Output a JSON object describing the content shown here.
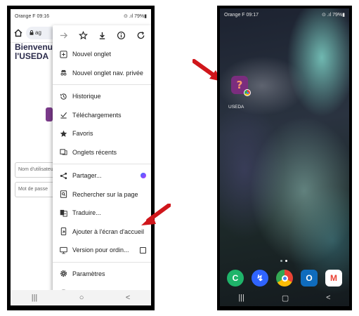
{
  "left_phone": {
    "status": {
      "carrier_time": "Orange F  09:16",
      "indicators": "⊙ .ıl 79%▮"
    },
    "url_text": "ag",
    "page": {
      "title": "Bienvenue l'USEDA",
      "username_placeholder": "Nom d'utilisateur",
      "password_placeholder": "Mot de passe"
    },
    "menu": {
      "items": [
        {
          "label": "Nouvel onglet",
          "icon": "new-tab-icon"
        },
        {
          "label": "Nouvel onglet nav. privée",
          "icon": "incognito-icon"
        },
        {
          "label": "Historique",
          "icon": "history-icon"
        },
        {
          "label": "Téléchargements",
          "icon": "downloads-icon"
        },
        {
          "label": "Favoris",
          "icon": "star-icon"
        },
        {
          "label": "Onglets récents",
          "icon": "recent-tabs-icon"
        },
        {
          "label": "Partager...",
          "icon": "share-icon"
        },
        {
          "label": "Rechercher sur la page",
          "icon": "find-in-page-icon"
        },
        {
          "label": "Traduire...",
          "icon": "translate-icon"
        },
        {
          "label": "Ajouter à l'écran d'accueil",
          "icon": "add-to-home-icon"
        },
        {
          "label": "Version pour ordin...",
          "icon": "desktop-icon"
        },
        {
          "label": "Paramètres",
          "icon": "settings-icon"
        }
      ]
    },
    "navbar": {
      "recent": "|||",
      "home": "○",
      "back": "<"
    }
  },
  "right_phone": {
    "status": {
      "carrier_time": "Orange F  09:17",
      "indicators": "⊙ .ıl 79%▮"
    },
    "app": {
      "label": "USEDA",
      "glyph": "?"
    },
    "dock": [
      {
        "icon": "phone-app-icon",
        "glyph": "C",
        "color": "#1fb46a"
      },
      {
        "icon": "messenger-app-icon",
        "glyph": "↯",
        "color": "#2f64ff"
      },
      {
        "icon": "chrome-app-icon",
        "glyph": "",
        "color": "#ffffff"
      },
      {
        "icon": "outlook-app-icon",
        "glyph": "O",
        "color": "#0f6cbd"
      },
      {
        "icon": "gmail-app-icon",
        "glyph": "M",
        "color": "#ffffff"
      }
    ],
    "navbar": {
      "recent": "|||",
      "home": "▢",
      "back": "<"
    }
  },
  "colors": {
    "arrow": "#d0161b",
    "useda_purple": "#7b2d7e"
  }
}
